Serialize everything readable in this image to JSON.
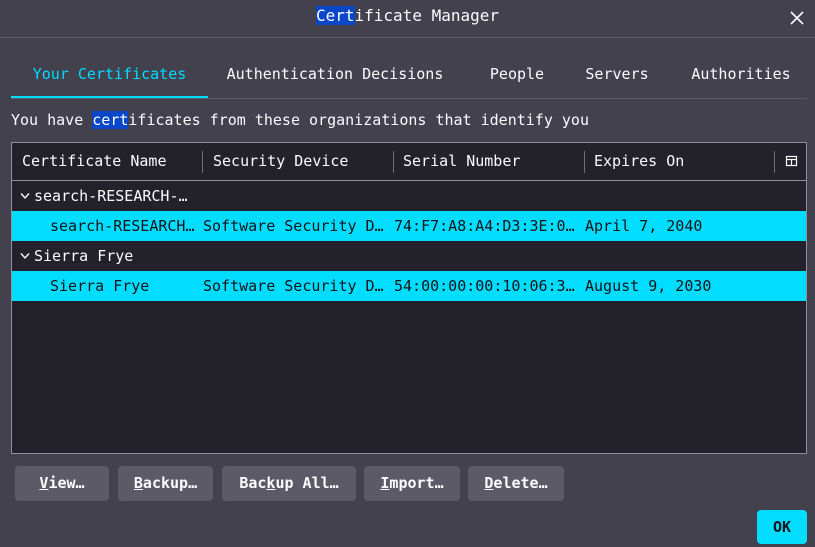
{
  "window": {
    "title_highlight": "Cert",
    "title_rest": "ificate Manager",
    "close_icon": "close-icon"
  },
  "tabs": [
    {
      "label": "Your Certificates",
      "active": true
    },
    {
      "label": "Authentication Decisions",
      "active": false
    },
    {
      "label": "People",
      "active": false
    },
    {
      "label": "Servers",
      "active": false
    },
    {
      "label": "Authorities",
      "active": false
    }
  ],
  "intro": {
    "before": "You have ",
    "highlight": "cert",
    "after": "ificates from these organizations that identify you"
  },
  "table": {
    "columns": [
      "Certificate Name",
      "Security Device",
      "Serial Number",
      "Expires On"
    ],
    "column_picker_icon": "column-picker-icon",
    "groups": [
      {
        "name": "search-RESEARCH-…",
        "expanded": true,
        "rows": [
          {
            "name": "search-RESEARCH…",
            "device": "Software Security D…",
            "serial": "74:F7:A8:A4:D3:3E:0…",
            "expires": "April 7, 2040",
            "selected": true
          }
        ]
      },
      {
        "name": "Sierra Frye",
        "expanded": true,
        "rows": [
          {
            "name": "Sierra Frye",
            "device": "Software Security D…",
            "serial": "54:00:00:00:10:06:3…",
            "expires": "August 9, 2030",
            "selected": true
          }
        ]
      }
    ]
  },
  "buttons": {
    "view": {
      "accel": "V",
      "rest": "iew…"
    },
    "backup": {
      "accel": "B",
      "rest": "ackup…"
    },
    "backup_all": {
      "pre": "Bac",
      "accel": "k",
      "rest": "up All…"
    },
    "import": {
      "accel": "I",
      "rest": "mport…"
    },
    "delete": {
      "accel": "D",
      "rest": "elete…"
    },
    "ok": "OK"
  },
  "colors": {
    "background": "#42414d",
    "accent": "#00ddff",
    "table_bg": "#23222b",
    "highlight": "#0a46c8"
  }
}
